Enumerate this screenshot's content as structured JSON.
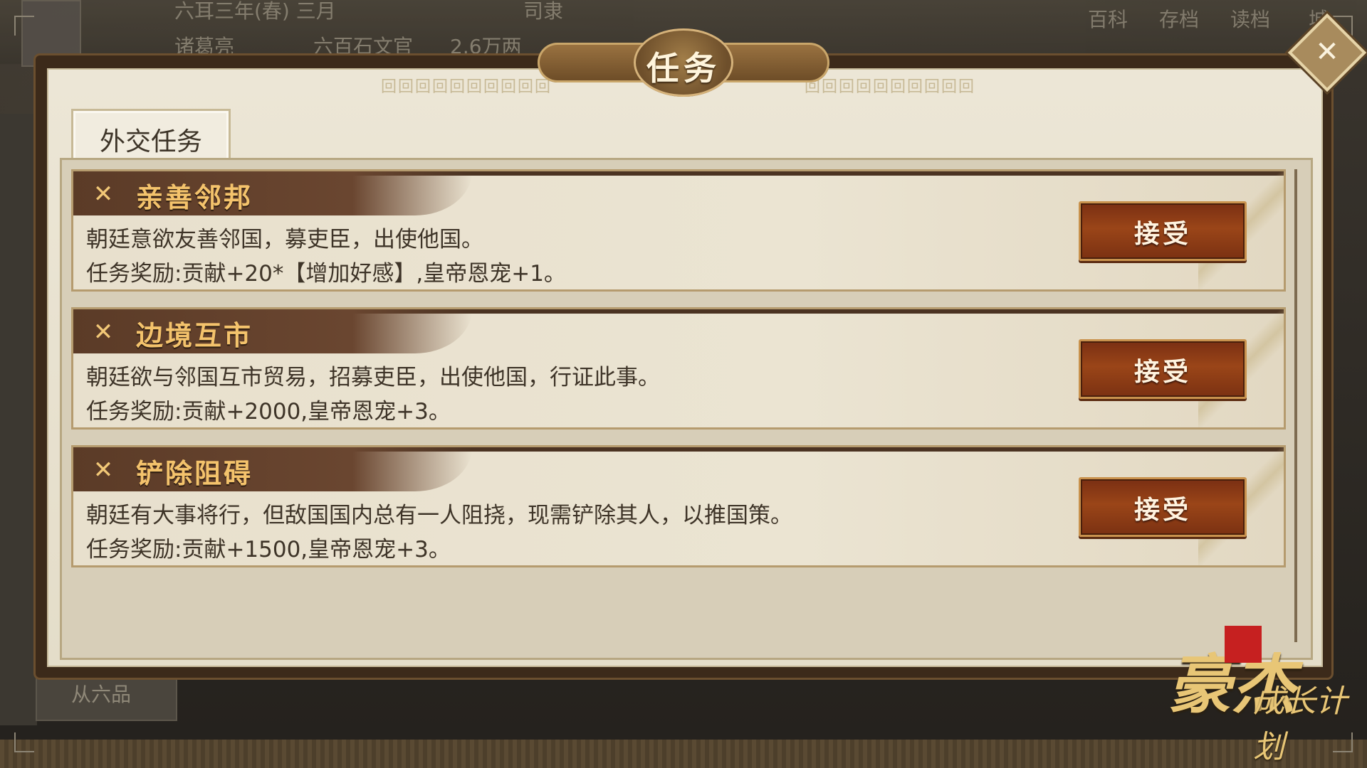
{
  "background": {
    "date": "六耳三年(春) 三月",
    "menu_item": "司隶",
    "player_name": "诸葛亮",
    "official_rank": "六百石文官",
    "money": "2.6万两",
    "top_menu": [
      "百科",
      "存档",
      "读档",
      "城"
    ],
    "side_rank": "从六品"
  },
  "dialog": {
    "title": "任务",
    "close_icon": "close-icon",
    "tabs": [
      {
        "label": "外交任务",
        "active": true
      }
    ]
  },
  "tasks": [
    {
      "name": "亲善邻邦",
      "description": "朝廷意欲友善邻国，募吏臣，出使他国。",
      "reward": "任务奖励:贡献+20*【增加好感】,皇帝恩宠+1。",
      "button": "接受"
    },
    {
      "name": "边境互市",
      "description": "朝廷欲与邻国互市贸易，招募吏臣，出使他国，行证此事。",
      "reward": "任务奖励:贡献+2000,皇帝恩宠+3。",
      "button": "接受"
    },
    {
      "name": "铲除阻碍",
      "description": "朝廷有大事将行，但敌国国内总有一人阻挠，现需铲除其人，以推国策。",
      "reward": "任务奖励:贡献+1500,皇帝恩宠+3。",
      "button": "接受"
    }
  ],
  "logo": {
    "big": "豪杰",
    "small": "成长计划",
    "seal": "豪杰"
  },
  "colors": {
    "task_name": "#f4c36c",
    "accept_button": "#9a4518",
    "panel_bg": "#ece6d6"
  }
}
